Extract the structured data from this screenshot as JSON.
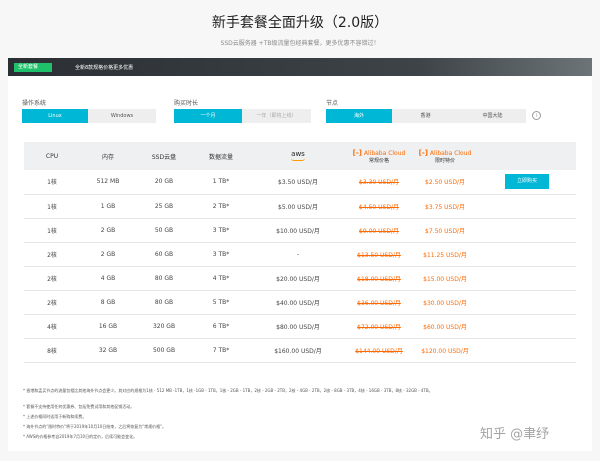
{
  "header": {
    "title": "新手套餐全面升级（2.0版）",
    "subtitle": "SSD云服务器 +TB级流量包经典套餐，更多优惠不容错过！"
  },
  "banner": {
    "tag": "全新套餐",
    "text": "全新8款规格价格更多优惠"
  },
  "options": {
    "os": {
      "label": "操作系统",
      "items": [
        "Linux",
        "Windows"
      ],
      "selected": 0
    },
    "duration": {
      "label": "购买时长",
      "items": [
        "一个月",
        "一年（即将上线）"
      ],
      "selected": 0
    },
    "region": {
      "label": "节点",
      "items": [
        "海外",
        "香港",
        "中国大陆"
      ],
      "selected": 0
    }
  },
  "table": {
    "headers": {
      "cpu": "CPU",
      "memory": "内存",
      "ssd": "SSD云盘",
      "traffic": "数据流量",
      "aws": "aws",
      "ali1_brand": "Alibaba Cloud",
      "ali1_sub": "常规价格",
      "ali2_brand": "Alibaba Cloud",
      "ali2_sub": "限时特价"
    },
    "rows": [
      {
        "cpu": "1核",
        "mem": "512 MB",
        "ssd": "20 GB",
        "traffic": "1 TB*",
        "aws": "$3.50 USD/月",
        "regular": "$3.30 USD/月",
        "special": "$2.50 USD/月"
      },
      {
        "cpu": "1核",
        "mem": "1 GB",
        "ssd": "25 GB",
        "traffic": "2 TB*",
        "aws": "$5.00 USD/月",
        "regular": "$4.50 USD/月",
        "special": "$3.75 USD/月"
      },
      {
        "cpu": "1核",
        "mem": "2 GB",
        "ssd": "50 GB",
        "traffic": "3 TB*",
        "aws": "$10.00 USD/月",
        "regular": "$9.00 USD/月",
        "special": "$7.50 USD/月"
      },
      {
        "cpu": "2核",
        "mem": "2 GB",
        "ssd": "60 GB",
        "traffic": "3 TB*",
        "aws": "-",
        "regular": "$13.50 USD/月",
        "special": "$11.25 USD/月"
      },
      {
        "cpu": "2核",
        "mem": "4 GB",
        "ssd": "80 GB",
        "traffic": "4 TB*",
        "aws": "$20.00 USD/月",
        "regular": "$18.00 USD/月",
        "special": "$15.00 USD/月"
      },
      {
        "cpu": "2核",
        "mem": "8 GB",
        "ssd": "80 GB",
        "traffic": "5 TB*",
        "aws": "$40.00 USD/月",
        "regular": "$36.00 USD/月",
        "special": "$30.00 USD/月"
      },
      {
        "cpu": "4核",
        "mem": "16 GB",
        "ssd": "320 GB",
        "traffic": "6 TB*",
        "aws": "$80.00 USD/月",
        "regular": "$72.00 USD/月",
        "special": "$60.00 USD/月"
      },
      {
        "cpu": "8核",
        "mem": "32 GB",
        "ssd": "500 GB",
        "traffic": "7 TB*",
        "aws": "$160.00 USD/月",
        "regular": "$144.00 USD/月",
        "special": "$120.00 USD/月"
      }
    ],
    "buy_label": "立即购买"
  },
  "notes": [
    "* 香港和孟买节点的流量包相比其他海外节点会更少。其对应的规格为1核 - 512 MB -1TB，1核 -1GB - 1TB，1核 - 2GB - 1TB，2核 - 2GB - 2TB，2核 - 4GB - 2TB，2核 - 8GB - 3TB，4核 - 16GB - 3TB，8核 - 32GB - 4TB。",
    "* 套餐不支持使用任何优惠券、包括免费试用和其他促销活动。",
    "* 上述价格同时适用于新购和续费。",
    "* 海外节点的\"限时特价\"将于2019年10月10日结束，之后将恢复为\"常规价格\"。",
    "* AWS的价格参考自2019年7月10日的定价，后续可能会变化。"
  ],
  "watermark": "知乎 @聿纾",
  "colors": {
    "accent": "#00b7d6",
    "alibaba": "#ff6a00",
    "tag_green": "#1fc06a"
  }
}
